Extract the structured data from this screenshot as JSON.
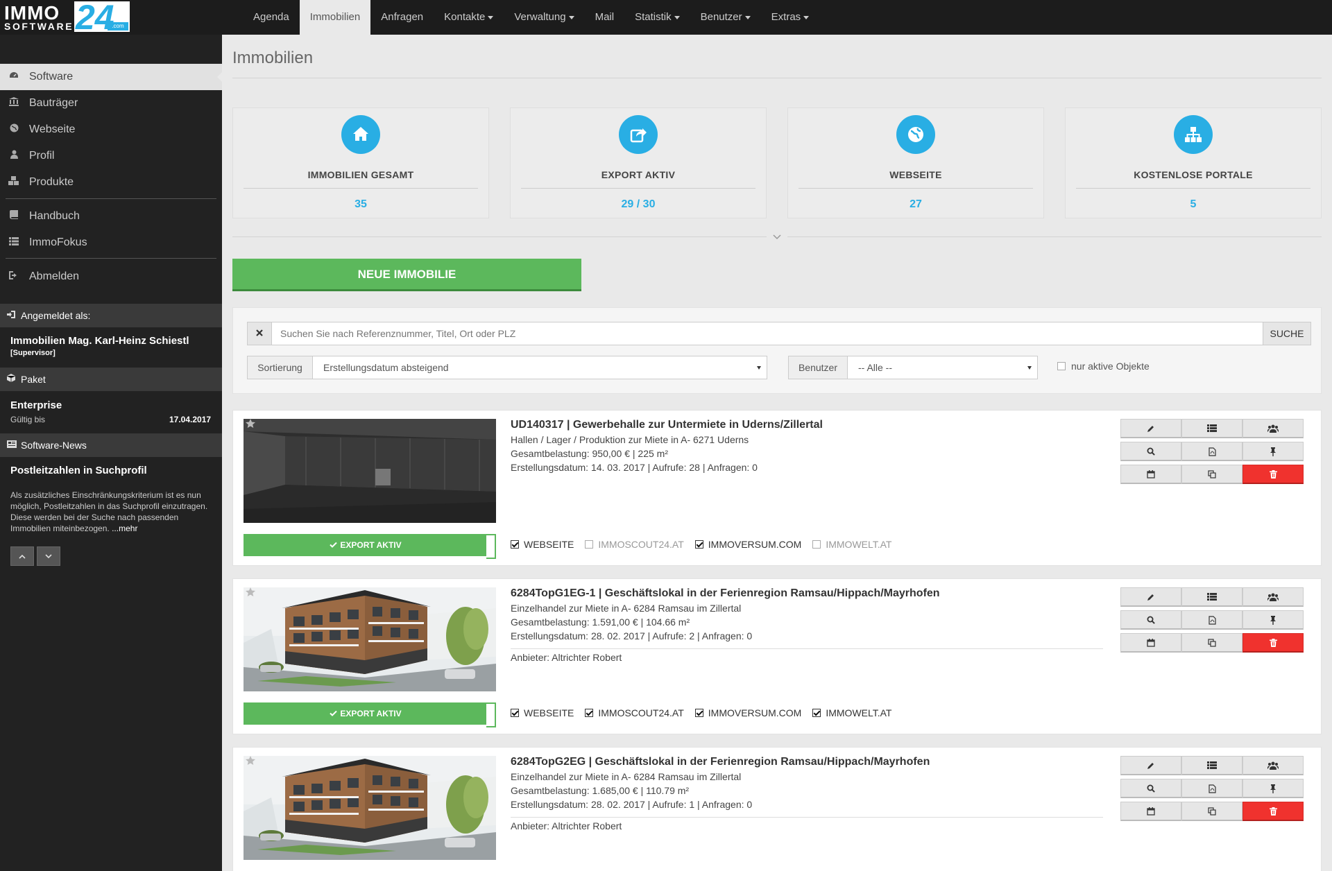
{
  "logo": {
    "immo": "IMMO",
    "software": "SOFTWARE",
    "number": "24",
    "dotcom": ".com"
  },
  "nav": [
    {
      "label": "Agenda",
      "dropdown": false
    },
    {
      "label": "Immobilien",
      "dropdown": false,
      "active": true
    },
    {
      "label": "Anfragen",
      "dropdown": false
    },
    {
      "label": "Kontakte",
      "dropdown": true
    },
    {
      "label": "Verwaltung",
      "dropdown": true
    },
    {
      "label": "Mail",
      "dropdown": false
    },
    {
      "label": "Statistik",
      "dropdown": true
    },
    {
      "label": "Benutzer",
      "dropdown": true
    },
    {
      "label": "Extras",
      "dropdown": true
    }
  ],
  "sidebar": {
    "items": [
      {
        "label": "Software",
        "icon": "dashboard-icon"
      },
      {
        "label": "Bauträger",
        "icon": "bank-icon"
      },
      {
        "label": "Webseite",
        "icon": "globe-icon"
      },
      {
        "label": "Profil",
        "icon": "user-icon"
      },
      {
        "label": "Produkte",
        "icon": "cubes-icon"
      },
      {
        "label": "Handbuch",
        "icon": "book-icon"
      },
      {
        "label": "ImmoFokus",
        "icon": "list-icon"
      },
      {
        "label": "Abmelden",
        "icon": "logout-icon"
      }
    ],
    "logged_in_header": "Angemeldet als:",
    "user_name": "Immobilien Mag. Karl-Heinz Schiestl",
    "user_role": "[Supervisor]",
    "package_header": "Paket",
    "package_name": "Enterprise",
    "valid_label": "Gültig bis",
    "valid_date": "17.04.2017",
    "news_header": "Software-News",
    "news_title": "Postleitzahlen in Suchprofil",
    "news_text": "Als zusätzliches Einschränkungskriterium ist es nun möglich, Postleitzahlen in das Suchprofil einzutragen. Diese werden bei der Suche nach passenden Immobilien miteinbezogen.",
    "news_more": "...mehr"
  },
  "main": {
    "page_title": "Immobilien",
    "stats": [
      {
        "label": "IMMOBILIEN GESAMT",
        "value": "35",
        "icon": "home-icon"
      },
      {
        "label": "EXPORT AKTIV",
        "value": "29 / 30",
        "icon": "share-icon"
      },
      {
        "label": "WEBSEITE",
        "value": "27",
        "icon": "globe-icon"
      },
      {
        "label": "KOSTENLOSE PORTALE",
        "value": "5",
        "icon": "sitemap-icon"
      }
    ],
    "new_button": "NEUE IMMOBILIE",
    "search": {
      "placeholder": "Suchen Sie nach Referenznummer, Titel, Ort oder PLZ",
      "button": "SUCHE",
      "sort_label": "Sortierung",
      "sort_value": "Erstellungsdatum absteigend",
      "user_label": "Benutzer",
      "user_value": "-- Alle --",
      "active_only_label": "nur aktive Objekte"
    }
  },
  "listings": [
    {
      "title": "UD140317 | Gewerbehalle zur Untermiete in Uderns/Zillertal",
      "line1": "Hallen / Lager / Produktion zur Miete in A- 6271 Uderns",
      "line2": "Gesamtbelastung: 950,00 € | 225 m²",
      "line3": "Erstellungsdatum: 14. 03. 2017 | Aufrufe: 28 | Anfragen: 0",
      "provider": "",
      "export": "EXPORT AKTIV",
      "photo": "hall",
      "portals": [
        {
          "label": "WEBSEITE",
          "checked": true
        },
        {
          "label": "IMMOSCOUT24.AT",
          "checked": false
        },
        {
          "label": "IMMOVERSUM.COM",
          "checked": true
        },
        {
          "label": "IMMOWELT.AT",
          "checked": false
        }
      ]
    },
    {
      "title": "6284TopG1EG-1 | Geschäftslokal in der Ferienregion Ramsau/Hippach/Mayrhofen",
      "line1": "Einzelhandel zur Miete in A- 6284 Ramsau im Zillertal",
      "line2": "Gesamtbelastung: 1.591,00 € | 104.66 m²",
      "line3": "Erstellungsdatum: 28. 02. 2017 | Aufrufe: 2 | Anfragen: 0",
      "provider": "Anbieter: Altrichter Robert",
      "export": "EXPORT AKTIV",
      "photo": "building",
      "portals": [
        {
          "label": "WEBSEITE",
          "checked": true
        },
        {
          "label": "IMMOSCOUT24.AT",
          "checked": true
        },
        {
          "label": "IMMOVERSUM.COM",
          "checked": true
        },
        {
          "label": "IMMOWELT.AT",
          "checked": true
        }
      ]
    },
    {
      "title": "6284TopG2EG | Geschäftslokal in der Ferienregion Ramsau/Hippach/Mayrhofen",
      "line1": "Einzelhandel zur Miete in A- 6284 Ramsau im Zillertal",
      "line2": "Gesamtbelastung: 1.685,00 € | 110.79 m²",
      "line3": "Erstellungsdatum: 28. 02. 2017 | Aufrufe: 1 | Anfragen: 0",
      "provider": "Anbieter: Altrichter Robert",
      "export": "",
      "photo": "building",
      "portals": []
    }
  ],
  "colors": {
    "accent": "#29aee4",
    "success": "#5cb85c",
    "danger": "#f0322e",
    "sidebar": "#222222",
    "topbar": "#1c1c1c"
  }
}
